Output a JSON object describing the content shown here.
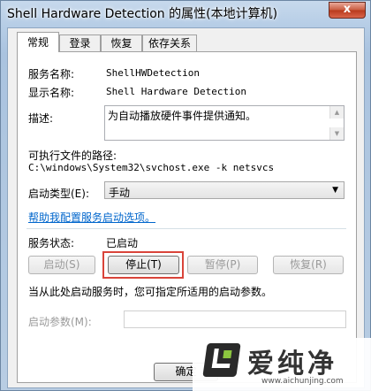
{
  "window": {
    "title": "Shell Hardware Detection 的属性(本地计算机)",
    "close_glyph": "x"
  },
  "tabs": [
    {
      "label": "常规"
    },
    {
      "label": "登录"
    },
    {
      "label": "恢复"
    },
    {
      "label": "依存关系"
    }
  ],
  "general": {
    "service_name_label": "服务名称:",
    "service_name_value": "ShellHWDetection",
    "display_name_label": "显示名称:",
    "display_name_value": "Shell Hardware Detection",
    "description_label": "描述:",
    "description_value": "为自动播放硬件事件提供通知。",
    "exe_path_label": "可执行文件的路径:",
    "exe_path_value": "C:\\windows\\System32\\svchost.exe -k netsvcs",
    "startup_type_label": "启动类型(E):",
    "startup_type_value": "手动",
    "help_link": "帮助我配置服务启动选项。",
    "status_label": "服务状态:",
    "status_value": "已启动",
    "buttons": {
      "start": "启动(S)",
      "stop": "停止(T)",
      "pause": "暂停(P)",
      "resume": "恢复(R)"
    },
    "start_params_hint": "当从此处启动服务时，您可指定所适用的启动参数。",
    "start_params_label": "启动参数(M):",
    "start_params_value": ""
  },
  "footer": {
    "ok_label": "确定"
  },
  "watermark": {
    "title": "爱纯净",
    "url": "www.aichunjing.com"
  }
}
